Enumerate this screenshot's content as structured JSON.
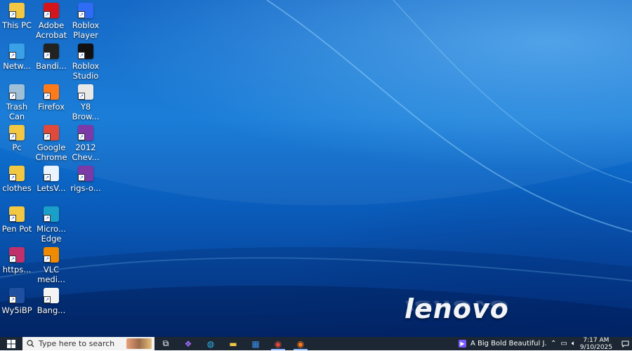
{
  "desktop": {
    "logo": "lenovo",
    "icons": [
      {
        "label": "This PC",
        "icon": "this-pc-icon",
        "color": "#f2c744",
        "col": 0,
        "row": 0
      },
      {
        "label": "Adobe Acrobat",
        "icon": "adobe-acrobat-icon",
        "color": "#d4161c",
        "col": 1,
        "row": 0
      },
      {
        "label": "Roblox Player",
        "icon": "roblox-player-icon",
        "color": "#2f6cf6",
        "col": 2,
        "row": 0
      },
      {
        "label": "Netw...",
        "icon": "network-icon",
        "color": "#3aa0e8",
        "col": 0,
        "row": 1
      },
      {
        "label": "Bandi...",
        "icon": "bandicam-icon",
        "color": "#222222",
        "col": 1,
        "row": 1
      },
      {
        "label": "Roblox Studio",
        "icon": "roblox-studio-icon",
        "color": "#111111",
        "col": 2,
        "row": 1
      },
      {
        "label": "Trash Can",
        "icon": "trash-can-icon",
        "color": "#9fbfd9",
        "col": 0,
        "row": 2
      },
      {
        "label": "Firefox",
        "icon": "firefox-icon",
        "color": "#ff7a1a",
        "col": 1,
        "row": 2
      },
      {
        "label": "Y8 Brow...",
        "icon": "y8-browser-icon",
        "color": "#e8e8e8",
        "col": 2,
        "row": 2
      },
      {
        "label": "Pc",
        "icon": "pc-folder-icon",
        "color": "#f2c744",
        "col": 0,
        "row": 3
      },
      {
        "label": "Google Chrome",
        "icon": "google-chrome-icon",
        "color": "#e04a3a",
        "col": 1,
        "row": 3
      },
      {
        "label": "2012 Chev...",
        "icon": "winrar-archive-icon",
        "color": "#7b3aa8",
        "col": 2,
        "row": 3
      },
      {
        "label": "clothes",
        "icon": "clothes-file-icon",
        "color": "#f2c744",
        "col": 0,
        "row": 4
      },
      {
        "label": "LetsV...",
        "icon": "letsview-icon",
        "color": "#e9f4ff",
        "col": 1,
        "row": 4
      },
      {
        "label": "rigs-o...",
        "icon": "winrar-archive-icon",
        "color": "#7b3aa8",
        "col": 2,
        "row": 4
      },
      {
        "label": "Pen Pot",
        "icon": "pen-pot-file-icon",
        "color": "#f2c744",
        "col": 0,
        "row": 5
      },
      {
        "label": "Micro... Edge",
        "icon": "microsoft-edge-icon",
        "color": "#1aa0c8",
        "col": 1,
        "row": 5
      },
      {
        "label": "https...",
        "icon": "web-shortcut-icon",
        "color": "#c0306a",
        "col": 0,
        "row": 6
      },
      {
        "label": "VLC medi...",
        "icon": "vlc-media-player-icon",
        "color": "#f08a00",
        "col": 1,
        "row": 6
      },
      {
        "label": "Wy5iBP",
        "icon": "wy5ibp-file-icon",
        "color": "#1f4fa0",
        "col": 0,
        "row": 7
      },
      {
        "label": "Bang...",
        "icon": "bang-file-icon",
        "color": "#f4f4f4",
        "col": 1,
        "row": 7
      }
    ]
  },
  "taskbar": {
    "search_placeholder": "Type here to search",
    "pinned": [
      {
        "name": "task-view-icon",
        "glyph": "⧉",
        "color": "#ffffff"
      },
      {
        "name": "copilot-icon",
        "glyph": "❖",
        "color": "#a86bff"
      },
      {
        "name": "microsoft-edge-icon",
        "glyph": "◍",
        "color": "#2fb0e8"
      },
      {
        "name": "file-explorer-icon",
        "glyph": "▬",
        "color": "#f2c744"
      },
      {
        "name": "microsoft-store-icon",
        "glyph": "▦",
        "color": "#3a8ee8"
      },
      {
        "name": "google-chrome-icon",
        "glyph": "◉",
        "color": "#e04a3a"
      },
      {
        "name": "firefox-icon",
        "glyph": "◉",
        "color": "#ff7a1a"
      }
    ],
    "media_title": "A Big Bold Beautiful J...",
    "time": "7:17 AM",
    "date": "9/10/2025"
  }
}
